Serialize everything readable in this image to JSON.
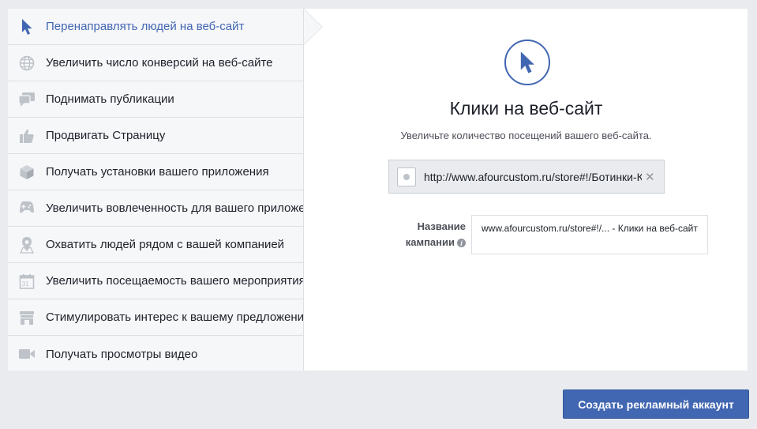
{
  "sidebar": {
    "items": [
      {
        "label": "Перенаправлять людей на веб-сайт",
        "icon": "cursor-icon",
        "active": true
      },
      {
        "label": "Увеличить число конверсий на веб-сайте",
        "icon": "globe-icon"
      },
      {
        "label": "Поднимать публикации",
        "icon": "chat-icon"
      },
      {
        "label": "Продвигать Страницу",
        "icon": "thumbs-up-icon"
      },
      {
        "label": "Получать установки вашего приложения",
        "icon": "cube-icon"
      },
      {
        "label": "Увеличить вовлеченность для вашего приложения",
        "icon": "gamepad-icon"
      },
      {
        "label": "Охватить людей рядом с вашей компанией",
        "icon": "location-pin-icon"
      },
      {
        "label": "Увеличить посещаемость вашего мероприятия",
        "icon": "calendar-icon"
      },
      {
        "label": "Стимулировать интерес к вашему предложению",
        "icon": "storefront-icon"
      },
      {
        "label": "Получать просмотры видео",
        "icon": "video-camera-icon"
      }
    ]
  },
  "main": {
    "title": "Клики на веб-сайт",
    "subtitle": "Увеличьте количество посещений вашего веб-сайта.",
    "url_value": "http://www.afourcustom.ru/store#!/Ботинки-Кож",
    "campaign_label": "Название кампании",
    "campaign_value": "www.afourcustom.ru/store#!/... - Клики на веб-сайт"
  },
  "footer": {
    "create_button_label": "Создать рекламный аккаунт"
  },
  "colors": {
    "accent": "#4267b2",
    "background": "#e9ebee",
    "icon_gray": "#bec3c9"
  }
}
